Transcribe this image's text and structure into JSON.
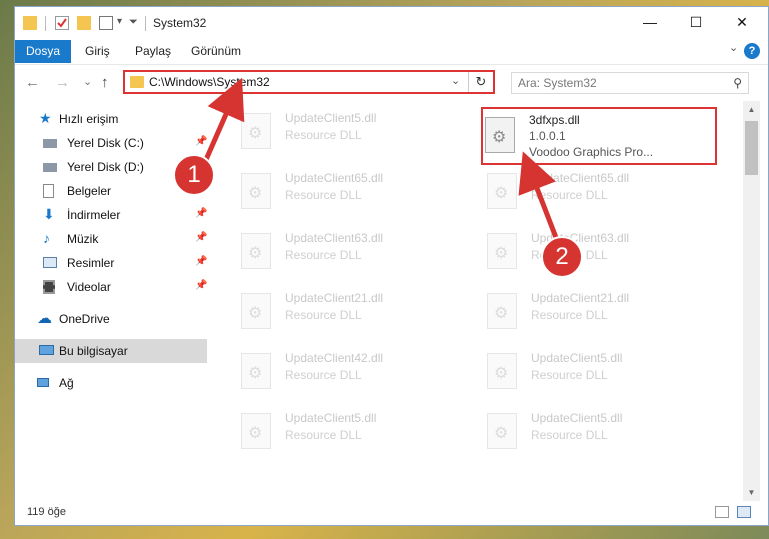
{
  "window": {
    "title": "System32",
    "minimize_glyph": "—",
    "maximize_glyph": "☐",
    "close_glyph": "✕"
  },
  "ribbon": {
    "file_tab": "Dosya",
    "tabs": [
      "Giriş",
      "Paylaş",
      "Görünüm"
    ],
    "expand_glyph": "⌄",
    "help_glyph": "?"
  },
  "address": {
    "back_glyph": "←",
    "forward_glyph": "→",
    "recent_glyph": "⌄",
    "up_glyph": "↑",
    "path": "C:\\Windows\\System32",
    "dropdown_glyph": "⌄",
    "refresh_glyph": "↻"
  },
  "search": {
    "placeholder": "Ara: System32",
    "icon_glyph": "⚲"
  },
  "sidebar": {
    "items": [
      {
        "label": "Hızlı erişim",
        "icon": "star-icon"
      },
      {
        "label": "Yerel Disk (C:)",
        "icon": "drive-icon",
        "pinned": true
      },
      {
        "label": "Yerel Disk (D:)",
        "icon": "drive-icon",
        "pinned": false
      },
      {
        "label": "Belgeler",
        "icon": "document-icon",
        "pinned": false
      },
      {
        "label": "İndirmeler",
        "icon": "download-icon",
        "pinned": true
      },
      {
        "label": "Müzik",
        "icon": "music-icon",
        "pinned": true
      },
      {
        "label": "Resimler",
        "icon": "pictures-icon",
        "pinned": true
      },
      {
        "label": "Videolar",
        "icon": "video-icon",
        "pinned": true
      },
      {
        "label": "OneDrive",
        "icon": "cloud-icon"
      },
      {
        "label": "Bu bilgisayar",
        "icon": "computer-icon",
        "selected": true
      },
      {
        "label": "Ağ",
        "icon": "network-icon"
      }
    ],
    "pin_glyph": "📌"
  },
  "files": {
    "highlighted": {
      "name": "3dfxps.dll",
      "version": "1.0.0.1",
      "description": "Voodoo Graphics Pro..."
    },
    "left_column": [
      {
        "name": "UpdateClient5.dll",
        "description": "Resource DLL"
      },
      {
        "name": "UpdateClient65.dll",
        "description": "Resource DLL"
      },
      {
        "name": "UpdateClient63.dll",
        "description": "Resource DLL"
      },
      {
        "name": "UpdateClient21.dll",
        "description": "Resource DLL"
      },
      {
        "name": "UpdateClient42.dll",
        "description": "Resource DLL"
      },
      {
        "name": "UpdateClient5.dll",
        "description": "Resource DLL"
      }
    ],
    "right_column": [
      {
        "name": "UpdateClient65.dll",
        "description": "Resource DLL"
      },
      {
        "name": "UpdateClient63.dll",
        "description": "Resource DLL"
      },
      {
        "name": "UpdateClient21.dll",
        "description": "Resource DLL"
      },
      {
        "name": "UpdateClient5.dll",
        "description": "Resource DLL"
      },
      {
        "name": "UpdateClient5.dll",
        "description": "Resource DLL"
      }
    ]
  },
  "status": {
    "count": "119 öğe"
  },
  "annotations": {
    "badge_1": "1",
    "badge_2": "2",
    "color": "#d63431"
  }
}
